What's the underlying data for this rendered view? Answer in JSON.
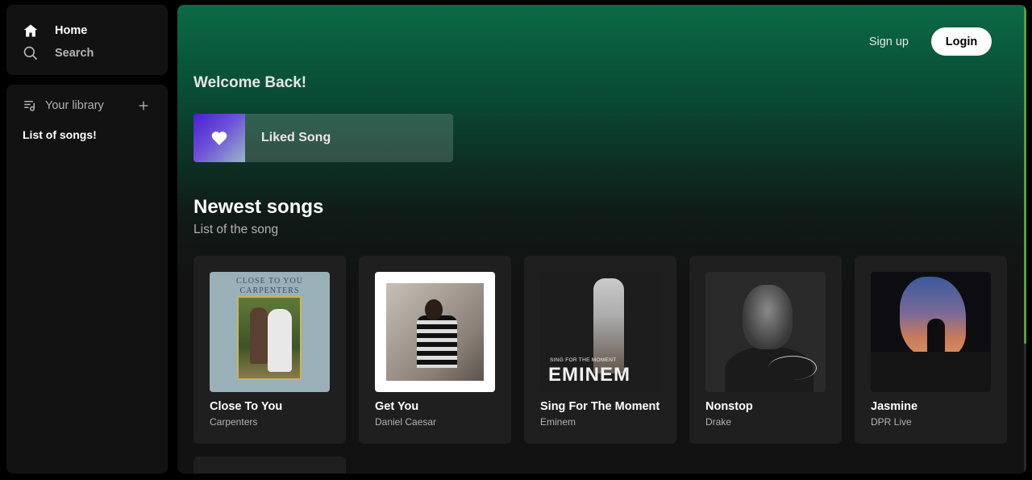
{
  "nav": {
    "home_label": "Home",
    "search_label": "Search"
  },
  "library": {
    "title": "Your library",
    "list_title": "List of songs!"
  },
  "header": {
    "signup_label": "Sign up",
    "login_label": "Login"
  },
  "main": {
    "welcome": "Welcome Back!",
    "liked_label": "Liked Song",
    "section_title": "Newest songs",
    "section_subtitle": "List of the song"
  },
  "songs": [
    {
      "title": "Close To You",
      "artist": "Carpenters",
      "cover_text_1": "CLOSE TO YOU",
      "cover_text_2": "CARPENTERS"
    },
    {
      "title": "Get You",
      "artist": "Daniel Caesar"
    },
    {
      "title": "Sing For The Moment",
      "artist": "Eminem",
      "cover_text_small": "SING FOR THE MOMENT",
      "cover_text_big": "EMINEM"
    },
    {
      "title": "Nonstop",
      "artist": "Drake"
    },
    {
      "title": "Jasmine",
      "artist": "DPR Live"
    }
  ],
  "colors": {
    "accent": "#1db954",
    "background": "#121212",
    "card": "#1f1f1f"
  }
}
